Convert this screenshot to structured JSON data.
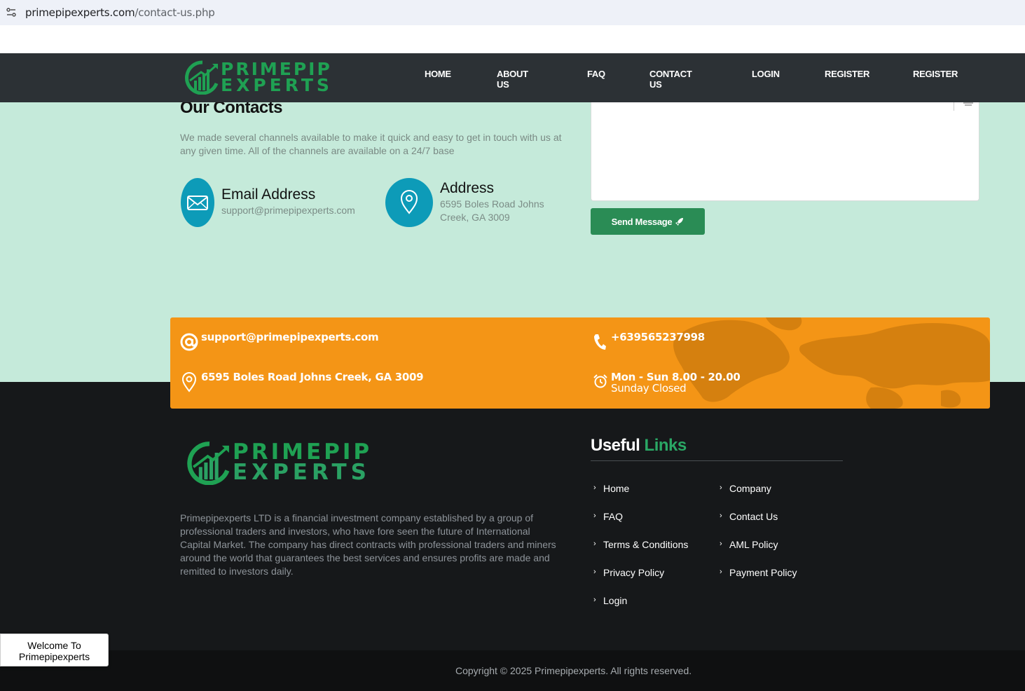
{
  "browser": {
    "url_host": "primepipexperts.com",
    "url_path": "/contact-us.php"
  },
  "brand": {
    "line1": "PRIMEPIP",
    "line2": "EXPERTS",
    "green": "#1fa153"
  },
  "nav": {
    "items": [
      {
        "label": "HOME"
      },
      {
        "label": "ABOUT US"
      },
      {
        "label": "FAQ"
      },
      {
        "label": "CONTACT US"
      },
      {
        "label": "LOGIN"
      },
      {
        "label": "REGISTER"
      },
      {
        "label": "REGISTER"
      }
    ]
  },
  "contacts": {
    "title": "Our Contacts",
    "description": "We made several channels available to make it quick and easy to get in touch with us at any given time. All of the channels are available on a 24/7 base",
    "email_title": "Email Address",
    "email_value": "support@primepipexperts.com",
    "address_title": "Address",
    "address_value": "6595 Boles Road Johns Creek, GA 3009",
    "send_label": "Send Message"
  },
  "info_bar": {
    "email": "support@primepipexperts.com",
    "phone": "+639565237998",
    "address": "6595 Boles Road Johns Creek, GA 3009",
    "hours": "Mon - Sun 8.00 - 20.00",
    "hours_note": "Sunday Closed",
    "color": "#f49516"
  },
  "footer": {
    "about": "Primepipexperts LTD is a financial investment company established by a group of professional traders and investors, who have fore seen the future of International Capital Market. The company has direct contracts with professional traders and miners around the world that guarantees the best services and ensures profits are made and remitted to investors daily.",
    "useful_word": "Useful",
    "links_word": "Links",
    "links_col1": [
      "Home",
      "FAQ",
      "Terms & Conditions",
      "Privacy Policy",
      "Login"
    ],
    "links_col2": [
      "Company",
      "Contact Us",
      "AML Policy",
      "Payment Policy"
    ],
    "copyright": "Copyright © 2025 Primepipexperts. All rights reserved."
  },
  "widget": {
    "line1": "Welcome To",
    "line2": "Primepipexperts"
  },
  "icons": {
    "email": "envelope-icon",
    "address": "map-pin-icon",
    "at": "at-sign-icon",
    "phone": "phone-icon",
    "clock": "alarm-clock-icon",
    "send": "rocket-icon",
    "chevron": "chevron-right-icon"
  }
}
